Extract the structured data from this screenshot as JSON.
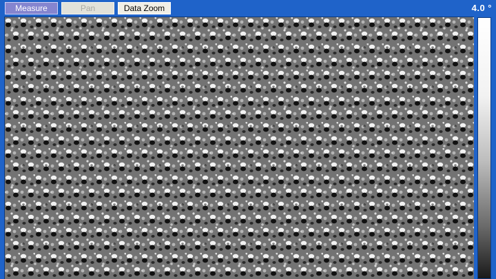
{
  "toolbar": {
    "measure_label": "Measure",
    "pan_label": "Pan",
    "data_zoom_label": "Data Zoom"
  },
  "scale": {
    "max_label": "4.0 °"
  },
  "colors": {
    "window_background": "#1f63c9",
    "measure_active": "#8585cf",
    "pan_disabled": "#e2e2da",
    "zoom_button": "#f0efe6"
  },
  "image": {
    "kind": "grayscale periodic lattice image",
    "pattern": "hexagonal lattice of bright and dark blobs"
  },
  "colorbar": {
    "gradient": [
      "#ffffff",
      "#f2f2f2",
      "#bdbdbd",
      "#6a6a6a",
      "#1a1a1a"
    ]
  }
}
